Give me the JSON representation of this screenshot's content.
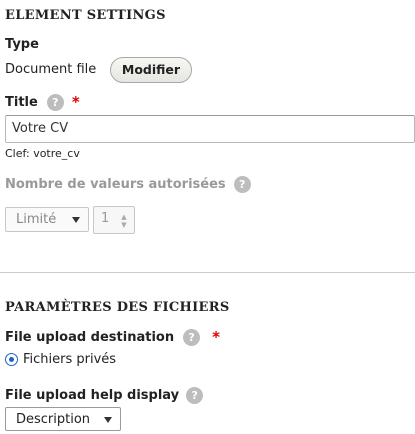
{
  "element_settings": {
    "heading": "ELEMENT SETTINGS",
    "type_label": "Type",
    "type_value": "Document file",
    "modify_button": "Modifier",
    "title_label": "Title",
    "title_value": "Votre CV",
    "key_text": "Clef: votre_cv",
    "allowed_values_label": "Nombre de valeurs autorisées",
    "limit_select": "Limité",
    "limit_number": "1"
  },
  "file_params": {
    "heading": "PARAMÈTRES DES FICHIERS",
    "upload_destination_label": "File upload destination",
    "destination_option": "Fichiers privés",
    "help_display_label": "File upload help display",
    "help_display_select": "Description"
  },
  "icons": {
    "help": "?",
    "required": "*",
    "spinner": "▲▼"
  },
  "colors": {
    "required": "#e00000",
    "radio_accent": "#1d63c2",
    "help_icon_bg": "#bdbdbd"
  }
}
